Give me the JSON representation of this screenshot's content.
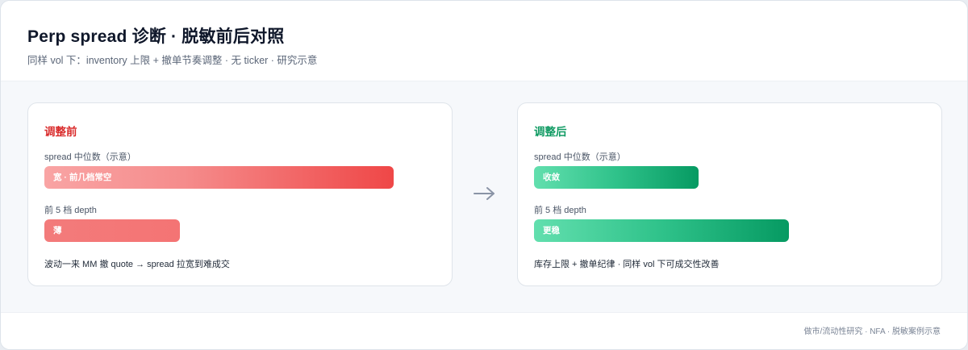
{
  "header": {
    "title": "Perp spread 诊断 · 脱敏前后对照",
    "subtitle": "同样 vol 下：inventory 上限 + 撤单节奏调整 · 无 ticker · 研究示意"
  },
  "before": {
    "title": "调整前",
    "spread_label": "spread 中位数（示意）",
    "spread_bar_text": "宽 · 前几档常空",
    "spread_level": 0.85,
    "depth_label": "前 5 档 depth",
    "depth_bar_text": "薄",
    "depth_level": 0.33,
    "note": "波动一来 MM 撤 quote → spread 拉宽到难成交",
    "accent": "#d92a2a"
  },
  "after": {
    "title": "调整后",
    "spread_label": "spread 中位数（示意）",
    "spread_bar_text": "收敛",
    "spread_level": 0.4,
    "depth_label": "前 5 档 depth",
    "depth_bar_text": "更稳",
    "depth_level": 0.62,
    "note": "库存上限 + 撤单纪律 · 同样 vol 下可成交性改善",
    "accent": "#0f9a62"
  },
  "arrow_icon": "arrow-right-icon",
  "footer": {
    "text": "做市/流动性研究 · NFA · 脱敏案例示意"
  }
}
